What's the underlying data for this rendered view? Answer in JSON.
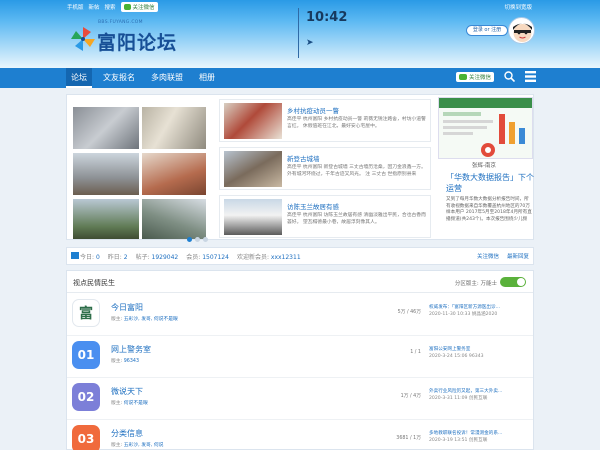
{
  "top": {
    "links": [
      "手机版",
      "新帖",
      "搜索"
    ],
    "wx_follow": "关注微信",
    "switch": "切换到宽版"
  },
  "logo": {
    "url": "BBS.FUYANG.COM",
    "title": "富阳论坛"
  },
  "clock": "10:42",
  "login": "登录 or 注册",
  "nav": {
    "tabs": [
      "论坛",
      "文友报名",
      "多肉联盟",
      "相册"
    ],
    "wx_follow": "关注微信"
  },
  "news": [
    {
      "title": "乡村抗疫动员一瞥",
      "desc": "高佳平 杭州富阳 乡村抗疫动员一瞥 莉薇无锐注路舍，村坊小道警言红。 休假值班在江北，最好安心宅屋中。"
    },
    {
      "title": "新登古城墙",
      "desc": "高佳平 杭州富阳 新登古城墙 三丈古墙历沧桑，因刀金浪鑫一方。 外有城河环绕过，千年古迹又风光。 注 三丈古 世指原别县来"
    },
    {
      "title": "访陈玉兰故居有感",
      "desc": "高佳平 杭州富阳 访陈玉兰故居有感 清幽淡雅出平民，合也古香而荟好。 望瓦榻德最小巷，故居浮刻像其人。"
    }
  ],
  "promo": {
    "name": "张辉-南京",
    "title": "「华数大数据报告」下个运营",
    "desc": "又到了每月华数大数据分析报告时间，所有收视数据来自华数覆盖杭州地区的70万样本用户 2017年5月至2018年4月所有直播频道(共243个)。本次报告围绕少儿频"
  },
  "stats": {
    "today_label": "今日:",
    "today": "0",
    "yesterday_label": "昨日:",
    "yesterday": "2",
    "posts_label": "帖子:",
    "posts": "1929042",
    "members_label": "会员:",
    "members": "1507124",
    "welcome_label": "欢迎新会员:",
    "newest": "xxx12311",
    "fav": "关注微信",
    "latest": "最新回复"
  },
  "forum": {
    "title": "视点民情民生",
    "option": "分区版主: 万能士",
    "rows": [
      {
        "icon_text": "富",
        "icon_color": "#ffffff",
        "name": "今日富阳",
        "mod_label": "版主:",
        "mods": "五彩沙, 发哥, 何说不是眼",
        "count": "5万 / 46万",
        "last_title": "权威发布：「富阳区新方源医出诊...",
        "last_meta": "2020-11-30 10:33 姚晶涵2020"
      },
      {
        "icon_text": "01",
        "icon_color": "#4a8ff0",
        "name": "网上警务室",
        "mod_label": "版主:",
        "mods": "96343",
        "count": "1 / 1",
        "last_title": "富阳公安网上警务室",
        "last_meta": "2020-3-24 15:06 96343"
      },
      {
        "icon_text": "02",
        "icon_color": "#7c7fd8",
        "name": "微说天下",
        "mod_label": "版主:",
        "mods": "何说不是眼",
        "count": "1万 / 4万",
        "last_title": "外卖行业风险厉又起，第三大外卖...",
        "last_meta": "2020-3-31 11:09 创民互联"
      },
      {
        "icon_text": "03",
        "icon_color": "#f06a3c",
        "name": "分类信息",
        "mod_label": "版主:",
        "mods": "五彩沙, 发哥, 何说",
        "count": "3681 / 1万",
        "last_title": "多地教职联名投诉！常漫测金的系...",
        "last_meta": "2020-3-19 13:51 创民互联"
      }
    ]
  }
}
